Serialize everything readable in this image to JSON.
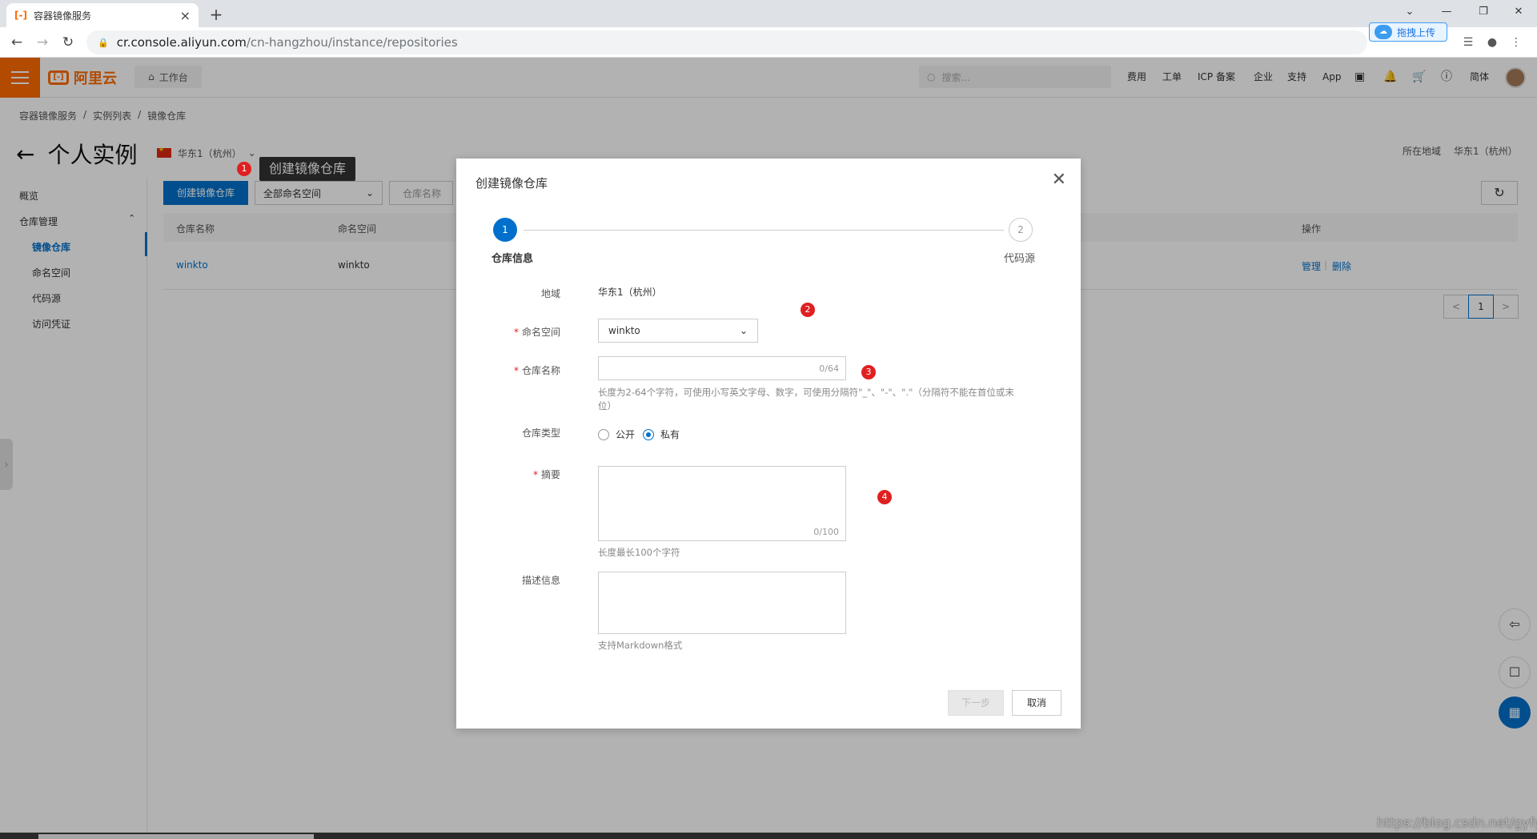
{
  "browser": {
    "tab_title": "容器镜像服务",
    "tab_favicon": "[-]",
    "url_host": "cr.console.aliyun.com",
    "url_path": "/cn-hangzhou/instance/repositories",
    "ext_upload_label": "拖拽上传"
  },
  "topnav": {
    "logo_text": "阿里云",
    "logo_mark": "[-]",
    "workbench": "工作台",
    "search_placeholder": "搜索...",
    "items": [
      "费用",
      "工单",
      "ICP 备案",
      "企业",
      "支持",
      "App"
    ],
    "lang": "简体"
  },
  "page": {
    "breadcrumb": [
      "容器镜像服务",
      "/",
      "实例列表",
      "/",
      "镜像仓库"
    ],
    "title": "个人实例",
    "region_selector": "华东1（杭州）",
    "region_right_label": "所在地域",
    "region_right_value": "华东1（杭州）",
    "sidebar": {
      "overview": "概览",
      "group": "仓库管理",
      "items": [
        "镜像仓库",
        "命名空间",
        "代码源",
        "访问凭证"
      ]
    },
    "toolbar": {
      "create": "创建镜像仓库",
      "ns_filter": "全部命名空间",
      "name_filter": "仓库名称"
    },
    "table": {
      "headers": [
        "仓库名称",
        "命名空间",
        "操作"
      ],
      "row": {
        "name": "winkto",
        "namespace": "winkto",
        "manage": "管理",
        "sep": "|",
        "delete": "删除"
      }
    },
    "pager": {
      "prev": "<",
      "current": "1",
      "next": ">"
    },
    "tooltip": "创建镜像仓库",
    "watermark": "https://blog.csdn.net/gyfghh"
  },
  "markers": [
    "1",
    "2",
    "3",
    "4"
  ],
  "dialog": {
    "title": "创建镜像仓库",
    "steps": [
      {
        "num": "1",
        "label": "仓库信息"
      },
      {
        "num": "2",
        "label": "代码源"
      }
    ],
    "region_label": "地域",
    "region_value": "华东1（杭州）",
    "namespace_label": "命名空间",
    "namespace_value": "winkto",
    "repo_name_label": "仓库名称",
    "repo_name_counter": "0/64",
    "repo_name_help": "长度为2-64个字符，可使用小写英文字母、数字，可使用分隔符\"_\"、\"-\"、\".\"（分隔符不能在首位或末位）",
    "repo_type_label": "仓库类型",
    "repo_type_options": [
      "公开",
      "私有"
    ],
    "repo_type_selected": "私有",
    "summary_label": "摘要",
    "summary_counter": "0/100",
    "summary_help": "长度最长100个字符",
    "desc_label": "描述信息",
    "desc_help": "支持Markdown格式",
    "next_button": "下一步",
    "cancel_button": "取消",
    "required_mark": "*"
  },
  "colors": {
    "brand_orange": "#ff6a00",
    "primary_blue": "#0070cc",
    "marker_red": "#e02020"
  }
}
